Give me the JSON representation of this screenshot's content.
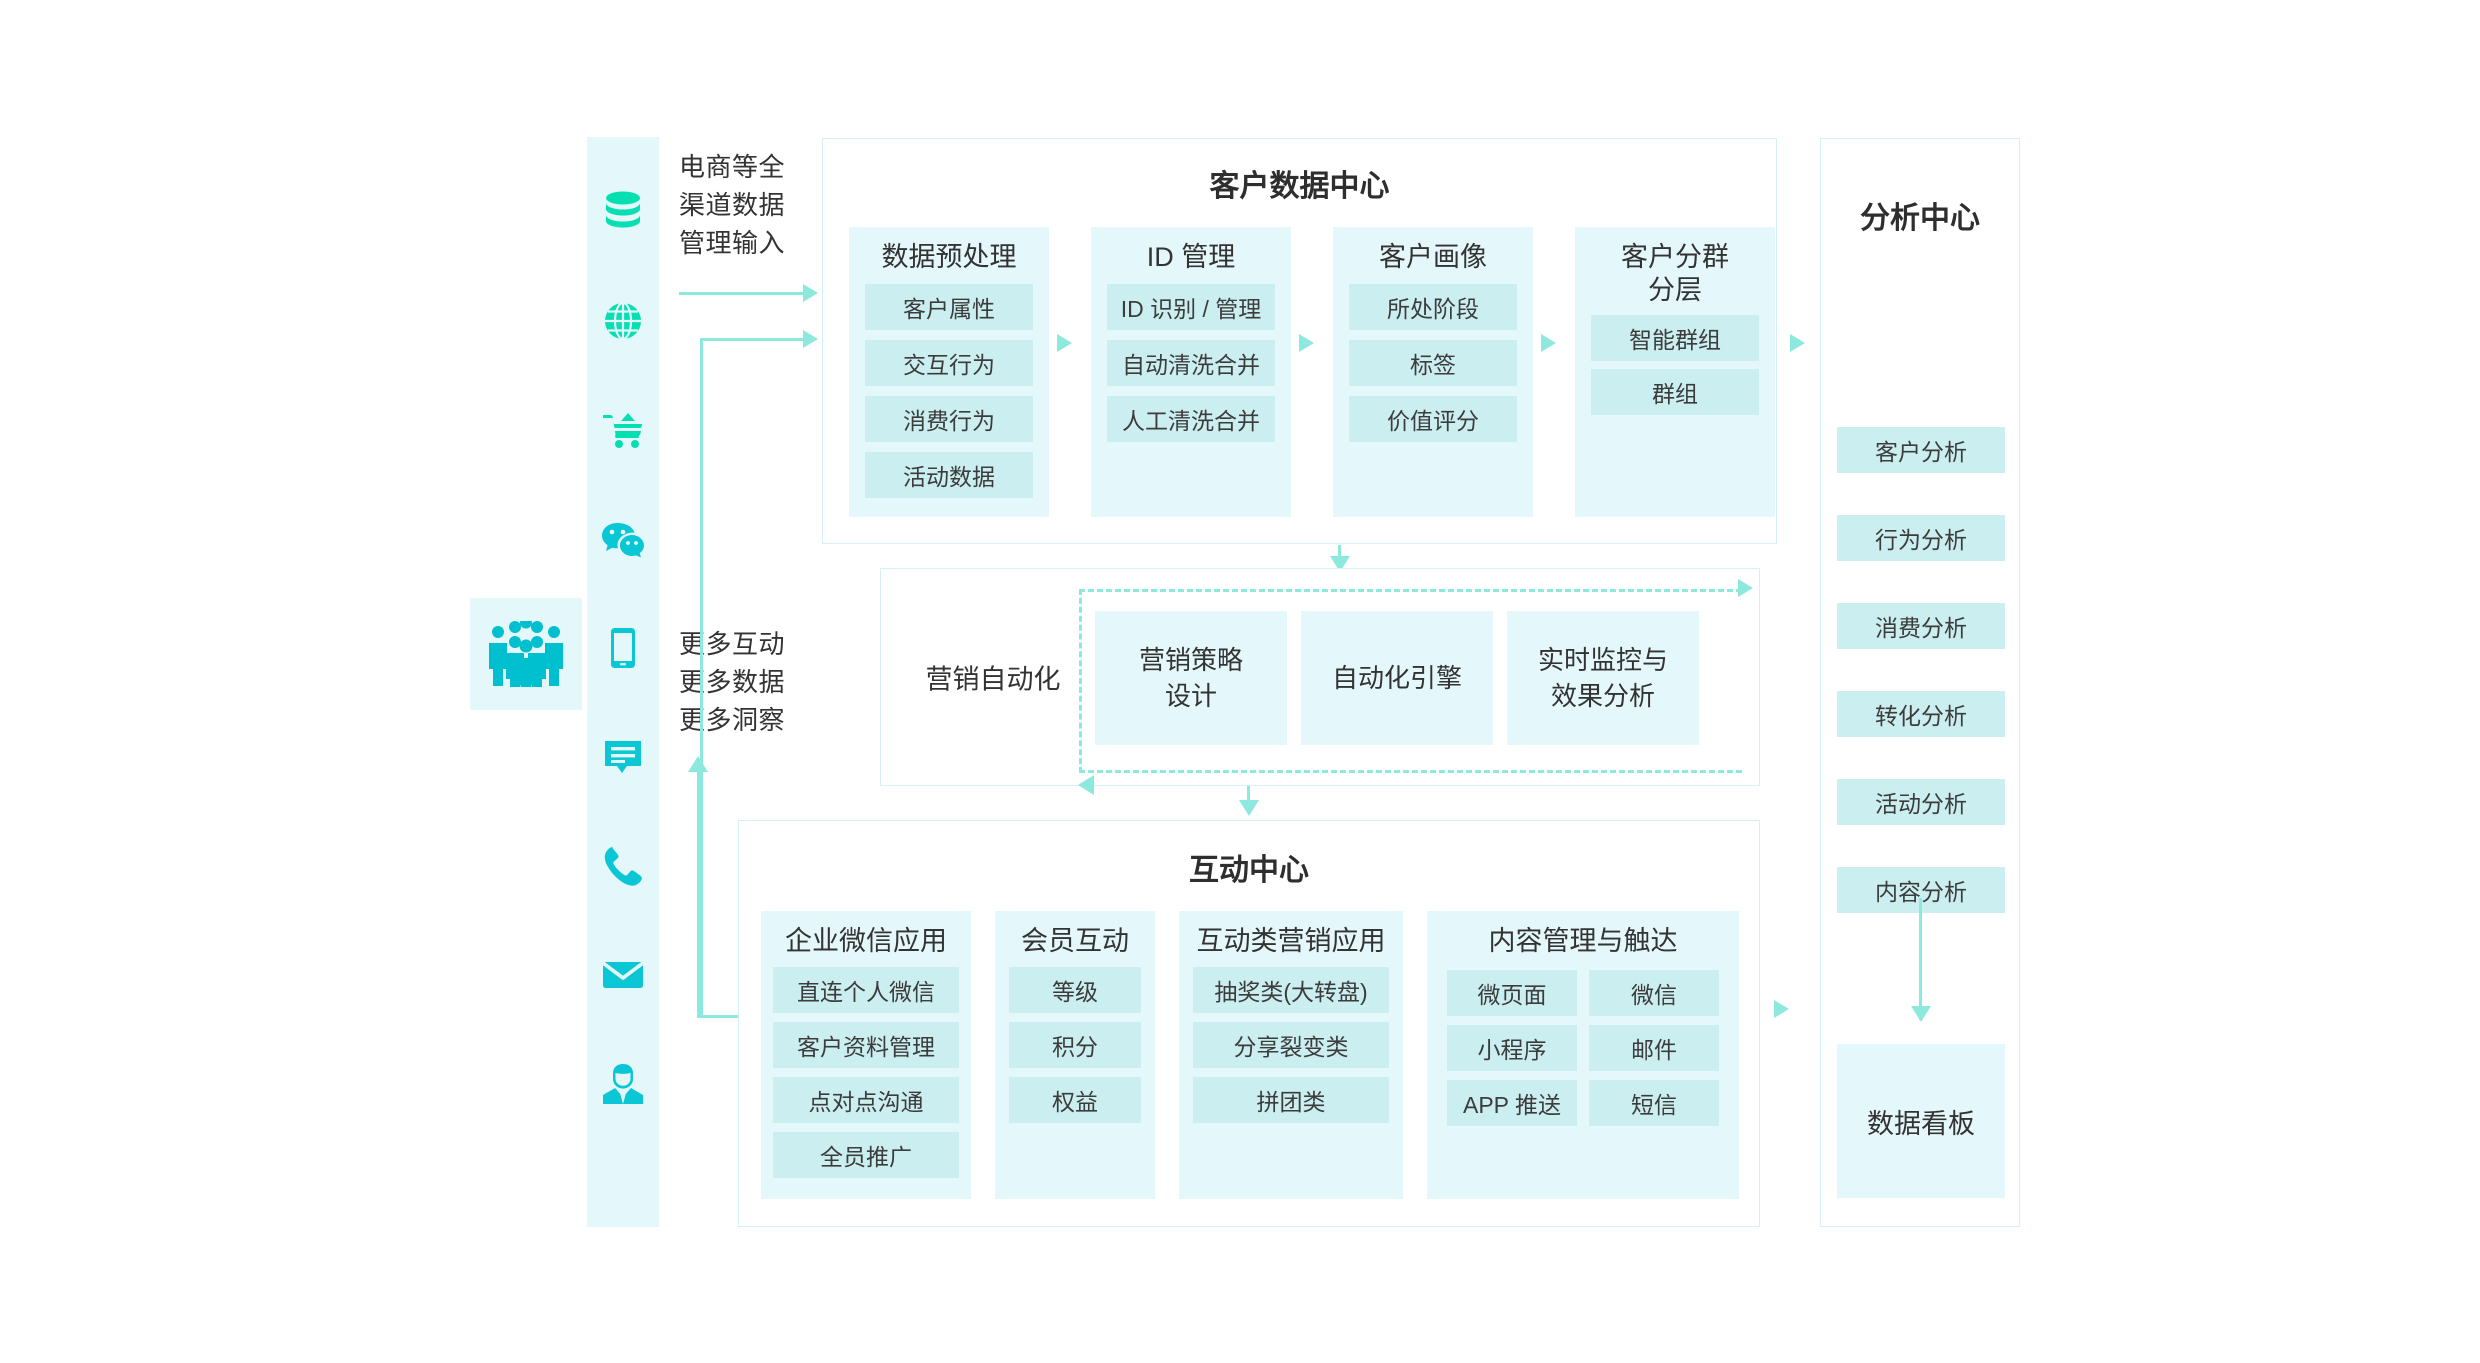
{
  "captions": {
    "input": "电商等全\n渠道数据\n管理输入",
    "more": "更多互动\n更多数据\n更多洞察"
  },
  "colors": {
    "accent": "#8de8dd",
    "icon": "#00c9c9",
    "panel_bg": "#e4f7fa",
    "chip_bg": "#cbeef0",
    "border": "#d5f1f6"
  },
  "channels": {
    "items": [
      {
        "name": "database-icon",
        "label": "数据库"
      },
      {
        "name": "globe-icon",
        "label": "网站"
      },
      {
        "name": "shopping-cart-icon",
        "label": "电商"
      },
      {
        "name": "wechat-icon",
        "label": "微信"
      },
      {
        "name": "mobile-phone-icon",
        "label": "移动端"
      },
      {
        "name": "chat-bubble-icon",
        "label": "在线客服"
      },
      {
        "name": "phone-call-icon",
        "label": "电话"
      },
      {
        "name": "envelope-icon",
        "label": "邮件"
      },
      {
        "name": "service-agent-icon",
        "label": "人工坐席"
      }
    ],
    "audience_icon": "people-group-icon"
  },
  "customer_data_center": {
    "title": "客户数据中心",
    "columns": [
      {
        "head": "数据预处理",
        "items": [
          "客户属性",
          "交互行为",
          "消费行为",
          "活动数据"
        ]
      },
      {
        "head": "ID 管理",
        "items": [
          "ID 识别 / 管理",
          "自动清洗合并",
          "人工清洗合并"
        ]
      },
      {
        "head": "客户画像",
        "items": [
          "所处阶段",
          "标签",
          "价值评分"
        ]
      },
      {
        "head": "客户分群\n分层",
        "items": [
          "智能群组",
          "群组"
        ]
      }
    ]
  },
  "marketing_automation": {
    "label": "营销自动化",
    "cards": [
      "营销策略\n设计",
      "自动化引擎",
      "实时监控与\n效果分析"
    ]
  },
  "interaction_center": {
    "title": "互动中心",
    "columns": [
      {
        "head": "企业微信应用",
        "items": [
          "直连个人微信",
          "客户资料管理",
          "点对点沟通",
          "全员推广"
        ]
      },
      {
        "head": "会员互动",
        "items": [
          "等级",
          "积分",
          "权益"
        ]
      },
      {
        "head": "互动类营销应用",
        "items": [
          "抽奖类(大转盘)",
          "分享裂变类",
          "拼团类"
        ]
      },
      {
        "head": "内容管理与触达",
        "items": [
          "微页面",
          "微信",
          "小程序",
          "邮件",
          "APP 推送",
          "短信"
        ]
      }
    ]
  },
  "analysis_center": {
    "title": "分析中心",
    "items": [
      "客户分析",
      "行为分析",
      "消费分析",
      "转化分析",
      "活动分析",
      "内容分析"
    ],
    "dashboard": "数据看板"
  }
}
